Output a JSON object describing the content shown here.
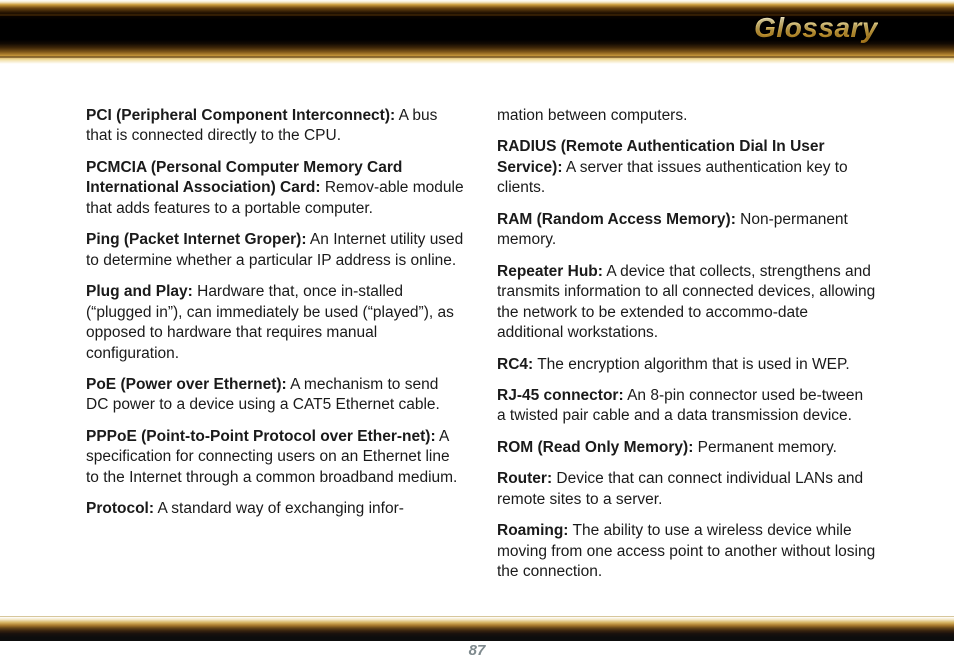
{
  "header": {
    "title": "Glossary"
  },
  "page_number": "87",
  "columns": [
    [
      {
        "term": "PCI (Peripheral Component Interconnect):",
        "def": "  A bus that is connected directly to the CPU."
      },
      {
        "term": "PCMCIA (Personal Computer Memory Card International Association) Card:",
        "def": "  Remov-able module that adds features to a portable computer."
      },
      {
        "term": "Ping (Packet Internet Groper):",
        "def": "  An Internet utility used to determine whether a particular IP address is online."
      },
      {
        "term": "Plug and Play:",
        "def": "  Hardware that, once in-stalled (“plugged in”), can immediately be used (“played”), as opposed to hardware that requires manual conﬁguration."
      },
      {
        "term": "PoE (Power over Ethernet):",
        "def": "  A mechanism to send DC power to a device using a CAT5 Ethernet cable."
      },
      {
        "term": "PPPoE (Point-to-Point Protocol over Ether-net):",
        "def": "  A speciﬁcation for connecting users on an Ethernet line to the Internet through a common broadband medium."
      },
      {
        "term": "Protocol:",
        "def": "  A standard way of exchanging infor-"
      }
    ],
    [
      {
        "term": "",
        "def": "mation between computers."
      },
      {
        "term": "RADIUS (Remote Authentication Dial In User Service):",
        "def": "  A server that issues authentication key to clients."
      },
      {
        "term": "RAM (Random Access Memory):",
        "def": "  Non-permanent memory."
      },
      {
        "term": "Repeater Hub:",
        "def": "  A device that collects, strengthens and transmits information to all connected devices, allowing the network to be extended to accommo-date additional workstations."
      },
      {
        "term": "RC4:",
        "def": "  The encryption algorithm that is used in WEP."
      },
      {
        "term": "RJ-45 connector:",
        "def": "  An 8-pin connector used be-tween a twisted pair cable and a data transmission device."
      },
      {
        "term": "ROM (Read Only Memory):",
        "def": "  Permanent memory."
      },
      {
        "term": "Router:",
        "def": "  Device that can connect individual LANs and remote sites to a server."
      },
      {
        "term": "Roaming:",
        "def": "  The ability to use a wireless device while moving from one access point to another without losing the connection."
      }
    ]
  ]
}
